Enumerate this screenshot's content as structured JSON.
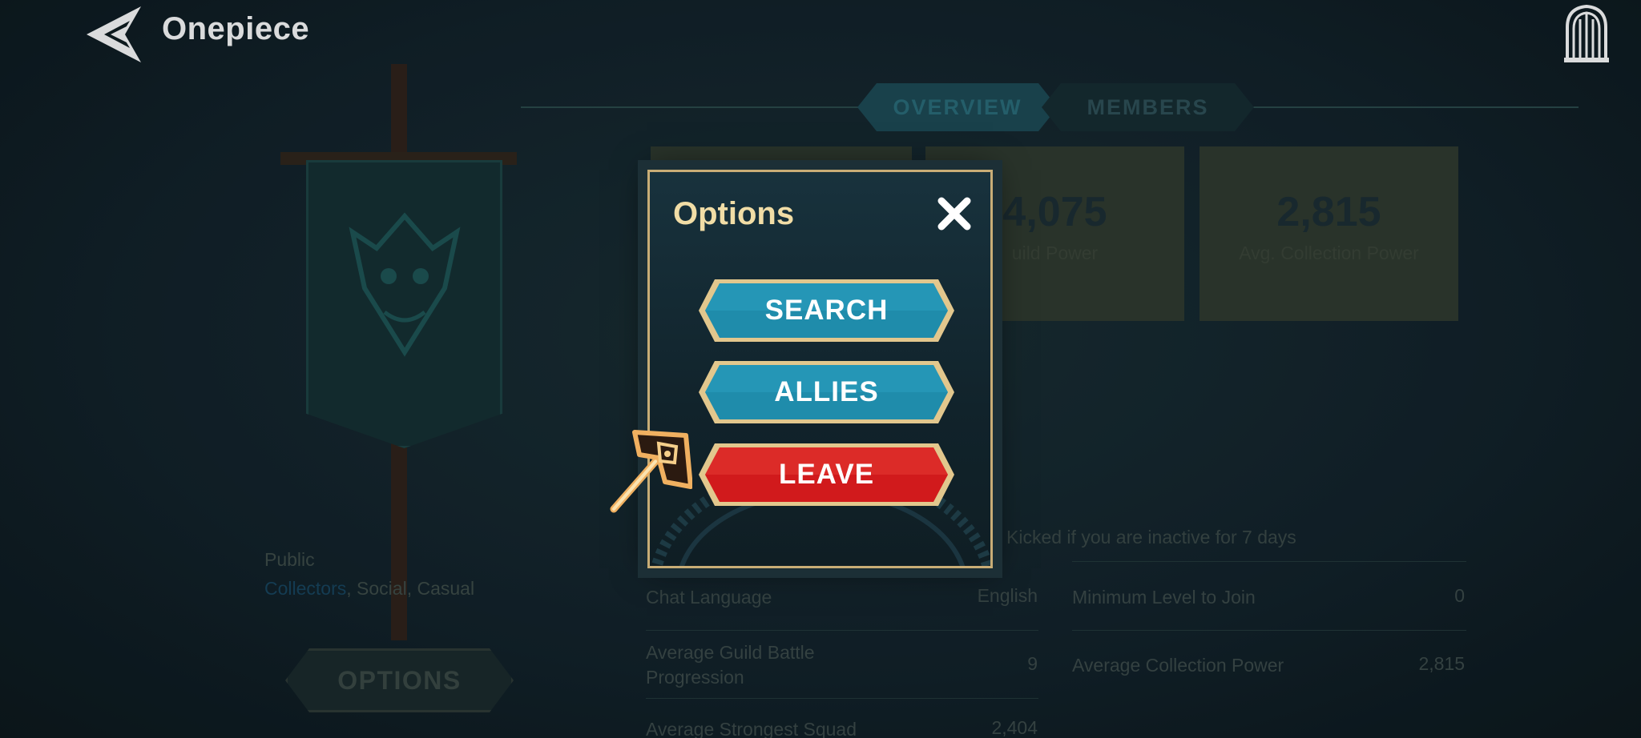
{
  "header": {
    "guild_name": "Onepiece",
    "back_icon": "back-arrow-icon",
    "exit_icon": "castle-door-icon"
  },
  "tabs": [
    {
      "label": "OVERVIEW",
      "active": true
    },
    {
      "label": "MEMBERS",
      "active": false
    }
  ],
  "banner": {
    "privacy": "Public",
    "tags": [
      "Collectors",
      "Social",
      "Casual"
    ],
    "tag_separator": ", ",
    "options_button": "OPTIONS"
  },
  "stats": [
    {
      "value": "",
      "label": ""
    },
    {
      "value": "4,075",
      "label": "uild Power"
    },
    {
      "value": "2,815",
      "label": "Avg. Collection Power"
    }
  ],
  "info": {
    "kick_note": "Kicked if you are inactive for 7 days",
    "rows": [
      {
        "label": "Chat Language",
        "value": "English"
      },
      {
        "label": "Minimum Level to Join",
        "value": "0"
      },
      {
        "label": "Average Guild Battle Progression",
        "value": "9"
      },
      {
        "label": "Average Collection Power",
        "value": "2,815"
      },
      {
        "label": "Average Strongest Squad",
        "value": "2,404"
      }
    ]
  },
  "modal": {
    "title": "Options",
    "close_icon": "close-x-icon",
    "buttons": [
      {
        "label": "SEARCH",
        "color": "#1f8cab"
      },
      {
        "label": "ALLIES",
        "color": "#1f8cab"
      },
      {
        "label": "LEAVE",
        "color": "#d11a1c"
      }
    ]
  },
  "colors": {
    "gold_trim": "#e2c78d",
    "title_gold": "#f1dda6",
    "teal_button": "#1f8cab",
    "red_button": "#d11a1c"
  }
}
